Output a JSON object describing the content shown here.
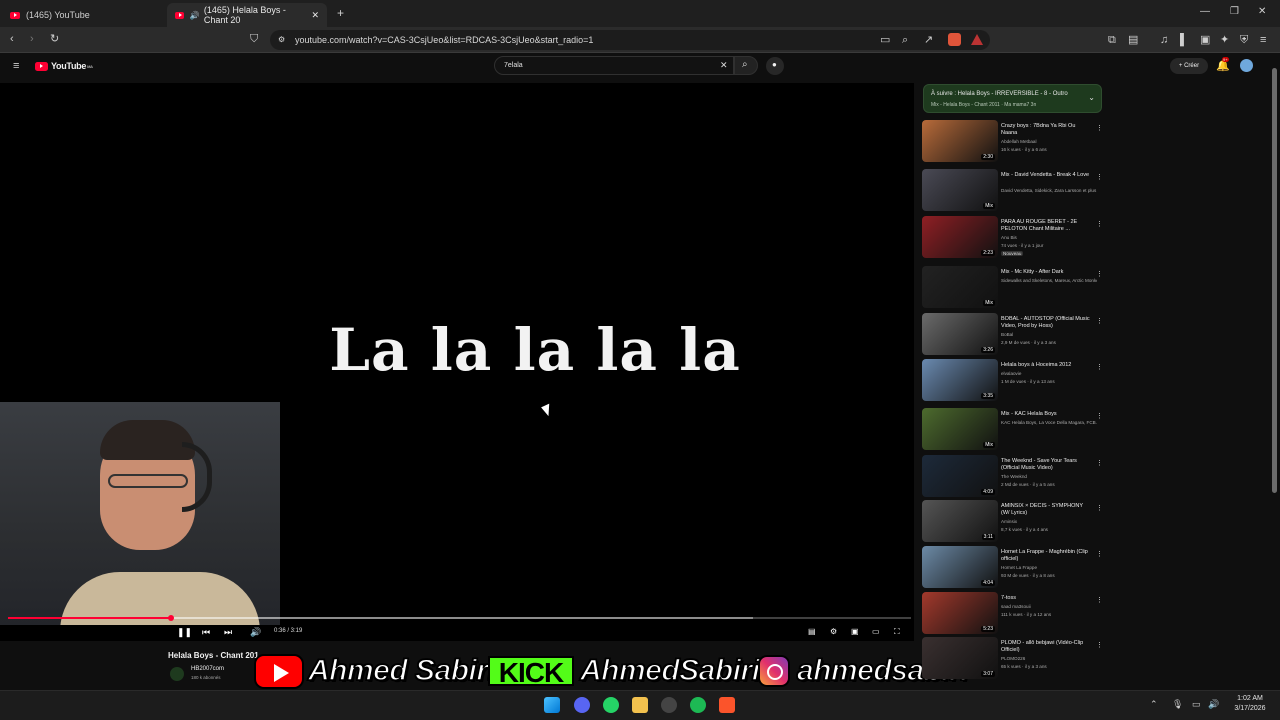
{
  "browser": {
    "tabs": [
      {
        "label": "(1465) YouTube"
      },
      {
        "label": "(1465) Helala Boys - Chant 20"
      }
    ],
    "new_tab": "+",
    "url": "youtube.com/watch?v=CAS-3CsjUeo&list=RDCAS-3CsjUeo&start_radio=1"
  },
  "youtube": {
    "logo": "YouTube",
    "logo_region": "MA",
    "search_value": "7elala",
    "create_label": "Créer",
    "notif_count": "9+"
  },
  "player": {
    "lyric": "La la la la la",
    "time": "0:36 / 3:19",
    "progress_fraction": 0.181,
    "buffered_fraction": 0.825
  },
  "video": {
    "title": "Helala Boys - Chant 201",
    "channel": "HB2007com",
    "subscribers": "180 k abonnés"
  },
  "up_next": {
    "title": "À suivre : Helala Boys - IRREVERSIBLE - 8 - Outro",
    "subtitle": "Mix - Helala Boys - Chant 2011 · Ma mama7 3n"
  },
  "related": [
    {
      "title": "Crazy boys : 7Bdna Ya Rbi Ou Naana",
      "channel": "Abdellah Metbaal",
      "meta": "16 k vues · il y a 6 ans",
      "duration": "2:30",
      "color": "#b86b3a"
    },
    {
      "title": "Mix - David Vendetta - Break 4 Love",
      "channel": "David Vendetta, Sidekick, Zara Larsson et plus",
      "meta": "",
      "duration": "Mix",
      "color": "#4a4a55"
    },
    {
      "title": "PARA AU ROUGE BERET - 2E PELOTON Chant Militaire ...",
      "channel": "Anu Bis",
      "meta": "74 vues · il y a 1 jour",
      "duration": "2:23",
      "color": "#8f1f24",
      "badge": "Nouveau"
    },
    {
      "title": "Mix - Mc Kitty - After Dark",
      "channel": "Sidewalks and Skeletons, Mareux, Arctic Monkeys",
      "meta": "",
      "duration": "Mix",
      "color": "#222"
    },
    {
      "title": "BOBAL - AUTOSTOP (Official Music Video, Prod by Hoss)",
      "channel": "BoBal",
      "meta": "2,9 M de vues · il y a 3 ans",
      "duration": "3:26",
      "color": "#6b6b6b"
    },
    {
      "title": "Helala boys à Hoceima 2012",
      "channel": "elvalaovie",
      "meta": "1 M de vues · il y a 13 ans",
      "duration": "3:35",
      "color": "#6a8ab0"
    },
    {
      "title": "Mix - KAC Helala Boys",
      "channel": "KAC Helala Boys, La Voce Della Magara, FCB...",
      "meta": "",
      "duration": "Mix",
      "color": "#4d6b2e"
    },
    {
      "title": "The Weeknd - Save Your Tears (Official Music Video)",
      "channel": "The Weeknd",
      "meta": "2 Md de vues · il y a 5 ans",
      "duration": "4:09",
      "color": "#1d2a3a"
    },
    {
      "title": "AMINSIX × DECIS - SYMPHONY (W/ Lyrics)",
      "channel": "Aminsix",
      "meta": "8,7 k vues · il y a 4 ans",
      "duration": "3:11",
      "color": "#555"
    },
    {
      "title": "Hornet La Frappe - Maghrébin (Clip officiel)",
      "channel": "Hornet La Frappe",
      "meta": "93 M de vues · il y a 8 ans",
      "duration": "4:04",
      "color": "#6c8aa6"
    },
    {
      "title": "7-toss",
      "channel": "saad ma3souii",
      "meta": "111 k vues · il y a 12 ans",
      "duration": "5:23",
      "color": "#a3392c"
    },
    {
      "title": "PLOMO - allô bebjawi (Vidéo-Clip Officiel)",
      "channel": "PLOMO226",
      "meta": "65 k vues · il y a 3 ans",
      "duration": "3:07",
      "color": "#3a3030"
    }
  ],
  "overlay": {
    "youtube_name": "Ahmed Sabiri",
    "kick_label": "KICK",
    "kick_name": "AhmedSabiri",
    "instagram_name": "ahmedsabiri"
  },
  "taskbar": {
    "time": "1:02 AM",
    "date": "3/17/2026"
  },
  "colors": {
    "accent": "#ff0033",
    "kick": "#53fc18",
    "background": "#0f0f0f"
  }
}
